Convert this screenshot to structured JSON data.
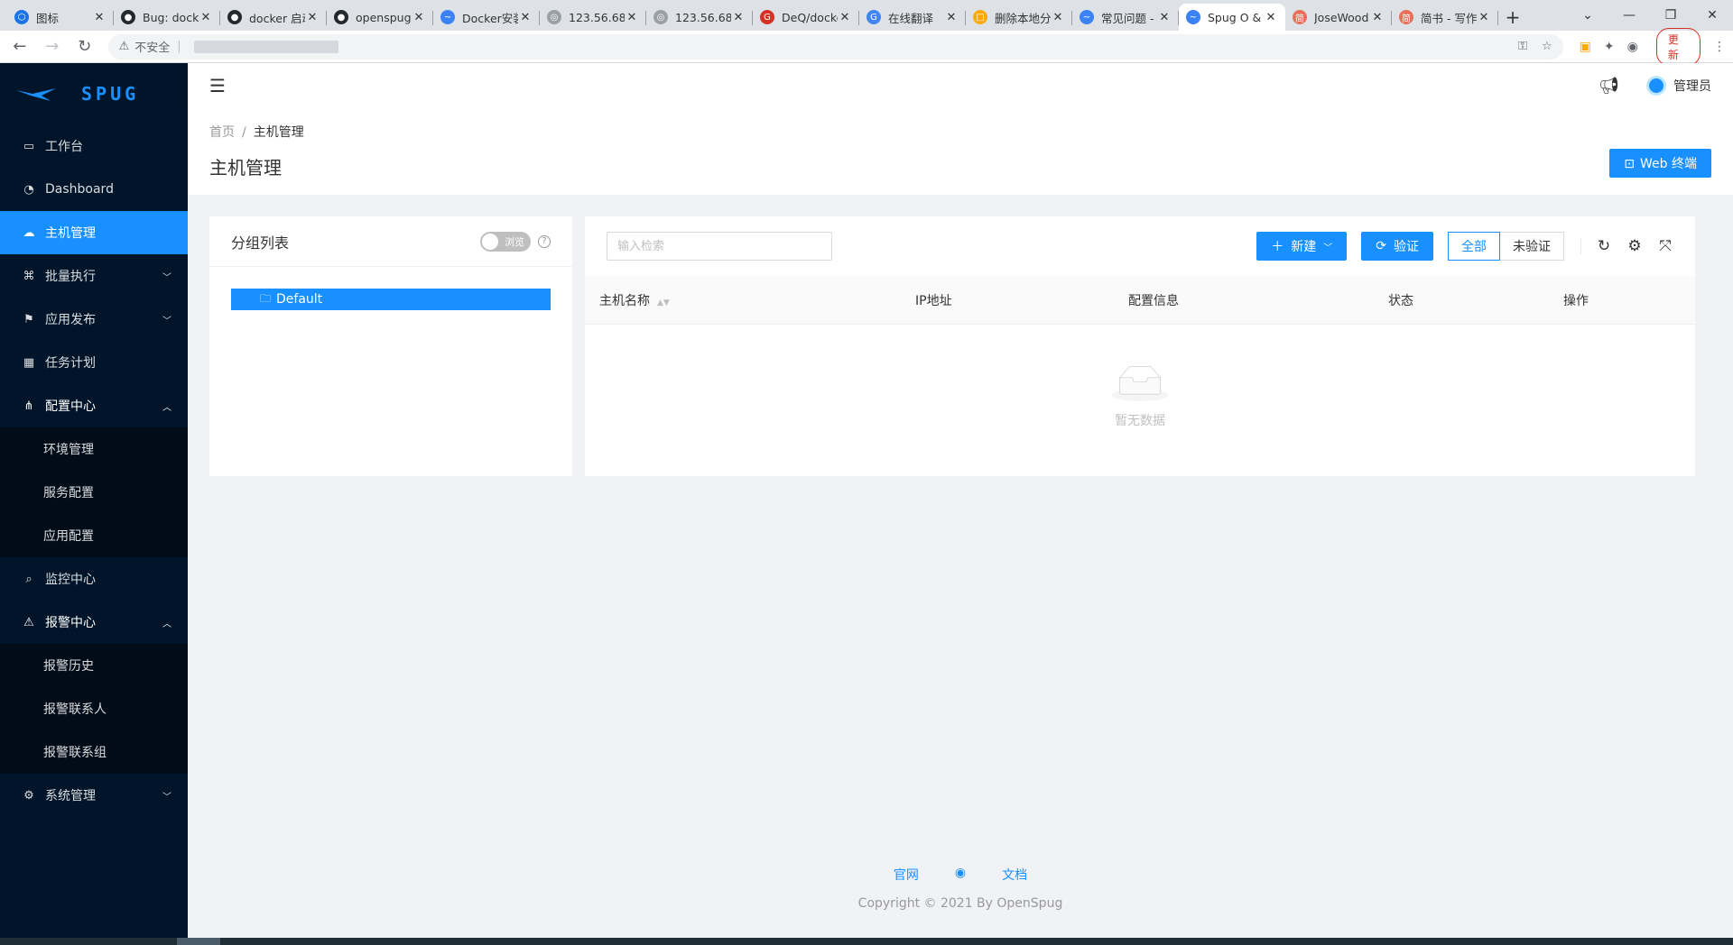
{
  "browser": {
    "tabs": [
      {
        "title": "图标",
        "fav_color": "#1a73e8",
        "fav": "⬡"
      },
      {
        "title": "Bug: docker",
        "fav_color": "#24292e",
        "fav": "●"
      },
      {
        "title": "docker 启动",
        "fav_color": "#24292e",
        "fav": "●"
      },
      {
        "title": "openspug",
        "fav_color": "#24292e",
        "fav": "●"
      },
      {
        "title": "Docker安装",
        "fav_color": "#3b82f6",
        "fav": "~"
      },
      {
        "title": "123.56.68",
        "fav_color": "#9aa0a6",
        "fav": "◎"
      },
      {
        "title": "123.56.68",
        "fav_color": "#9aa0a6",
        "fav": "◎"
      },
      {
        "title": "DeQ/docker",
        "fav_color": "#d93025",
        "fav": "G"
      },
      {
        "title": "在线翻译",
        "fav_color": "#4285f4",
        "fav": "G"
      },
      {
        "title": "删除本地分支",
        "fav_color": "#f9ab00",
        "fav": "□"
      },
      {
        "title": "常见问题 -",
        "fav_color": "#3b82f6",
        "fav": "~"
      },
      {
        "title": "Spug O & M",
        "fav_color": "#3b82f6",
        "fav": "~"
      },
      {
        "title": "JoseWood",
        "fav_color": "#ea6f5a",
        "fav": "简"
      },
      {
        "title": "简书 - 写作",
        "fav_color": "#ea6f5a",
        "fav": "简"
      }
    ],
    "active_tab": 11,
    "security_label": "不安全",
    "update_label": "更新"
  },
  "sidebar": {
    "brand": "SPUG",
    "items": [
      {
        "label": "工作台",
        "icon": "desktop-icon",
        "glyph": "▭"
      },
      {
        "label": "Dashboard",
        "icon": "dashboard-icon",
        "glyph": "◔"
      },
      {
        "label": "主机管理",
        "icon": "cloud-server-icon",
        "glyph": "☁"
      },
      {
        "label": "批量执行",
        "icon": "code-icon",
        "glyph": "⌘",
        "arrow": "﹀"
      },
      {
        "label": "应用发布",
        "icon": "flag-icon",
        "glyph": "⚑",
        "arrow": "﹀"
      },
      {
        "label": "任务计划",
        "icon": "schedule-icon",
        "glyph": "▦"
      },
      {
        "label": "配置中心",
        "icon": "deployment-icon",
        "glyph": "⋔",
        "arrow": "︿"
      }
    ],
    "config_sub": [
      "环境管理",
      "服务配置",
      "应用配置"
    ],
    "monitor": {
      "label": "监控中心",
      "glyph": "⌕"
    },
    "alarm": {
      "label": "报警中心",
      "glyph": "⚠",
      "arrow": "︿"
    },
    "alarm_sub": [
      "报警历史",
      "报警联系人",
      "报警联系组"
    ],
    "system": {
      "label": "系统管理",
      "glyph": "⚙",
      "arrow": "﹀"
    }
  },
  "header": {
    "username": "管理员"
  },
  "page": {
    "breadcrumb": [
      "首页",
      "主机管理"
    ],
    "title": "主机管理",
    "web_terminal": "Web 终端"
  },
  "group_panel": {
    "title": "分组列表",
    "switch_label": "浏览",
    "nodes": [
      "Default"
    ]
  },
  "host_panel": {
    "search_placeholder": "输入检索",
    "new_label": "新建",
    "verify_label": "验证",
    "filters": [
      "全部",
      "未验证"
    ],
    "active_filter": 0,
    "columns": [
      "主机名称",
      "IP地址",
      "配置信息",
      "状态",
      "操作"
    ],
    "empty_text": "暂无数据"
  },
  "footer": {
    "links": [
      "官网",
      "文档"
    ],
    "copyright": "Copyright © 2021 By OpenSpug"
  }
}
